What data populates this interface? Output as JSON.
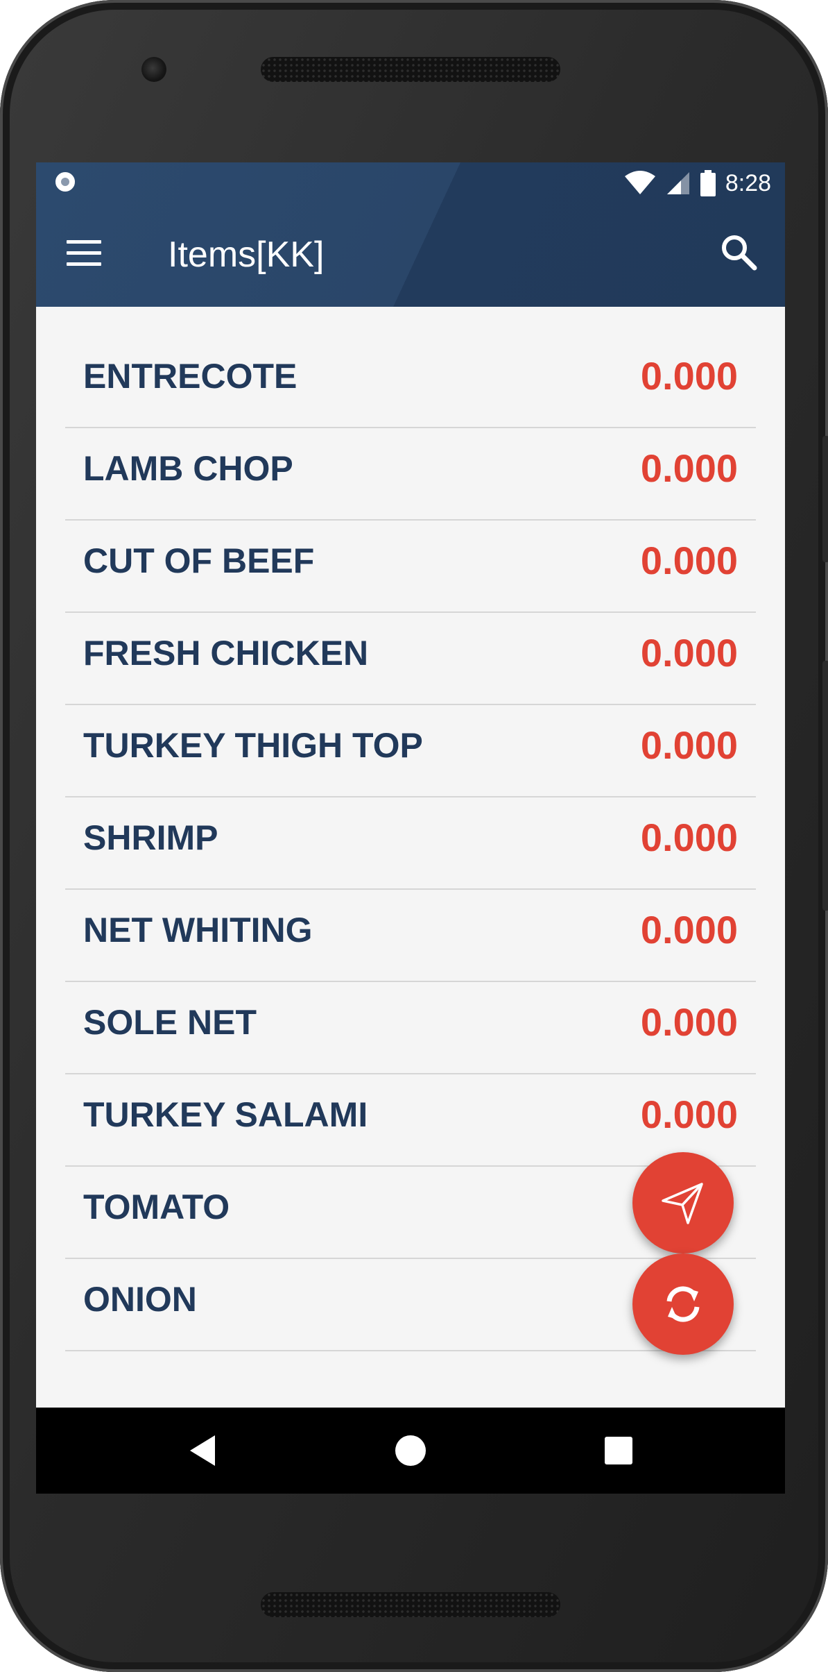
{
  "status_bar": {
    "time": "8:28"
  },
  "app_bar": {
    "title": "Items[KK]"
  },
  "items": [
    {
      "name": "ENTRECOTE",
      "value": "0.000"
    },
    {
      "name": "LAMB CHOP",
      "value": "0.000"
    },
    {
      "name": "CUT OF BEEF",
      "value": "0.000"
    },
    {
      "name": "FRESH CHICKEN",
      "value": "0.000"
    },
    {
      "name": "TURKEY THIGH TOP",
      "value": "0.000"
    },
    {
      "name": "SHRIMP",
      "value": "0.000"
    },
    {
      "name": "NET WHITING",
      "value": "0.000"
    },
    {
      "name": "SOLE NET",
      "value": "0.000"
    },
    {
      "name": "TURKEY SALAMI",
      "value": "0.000"
    },
    {
      "name": "TOMATO",
      "value": ""
    },
    {
      "name": "ONION",
      "value": ""
    }
  ],
  "fabs": {
    "send_icon": "send-icon",
    "sync_icon": "sync-icon"
  },
  "colors": {
    "app_bar": "#23405f",
    "item_text": "#21395a",
    "value_text": "#e14234",
    "fab": "#e14234"
  }
}
